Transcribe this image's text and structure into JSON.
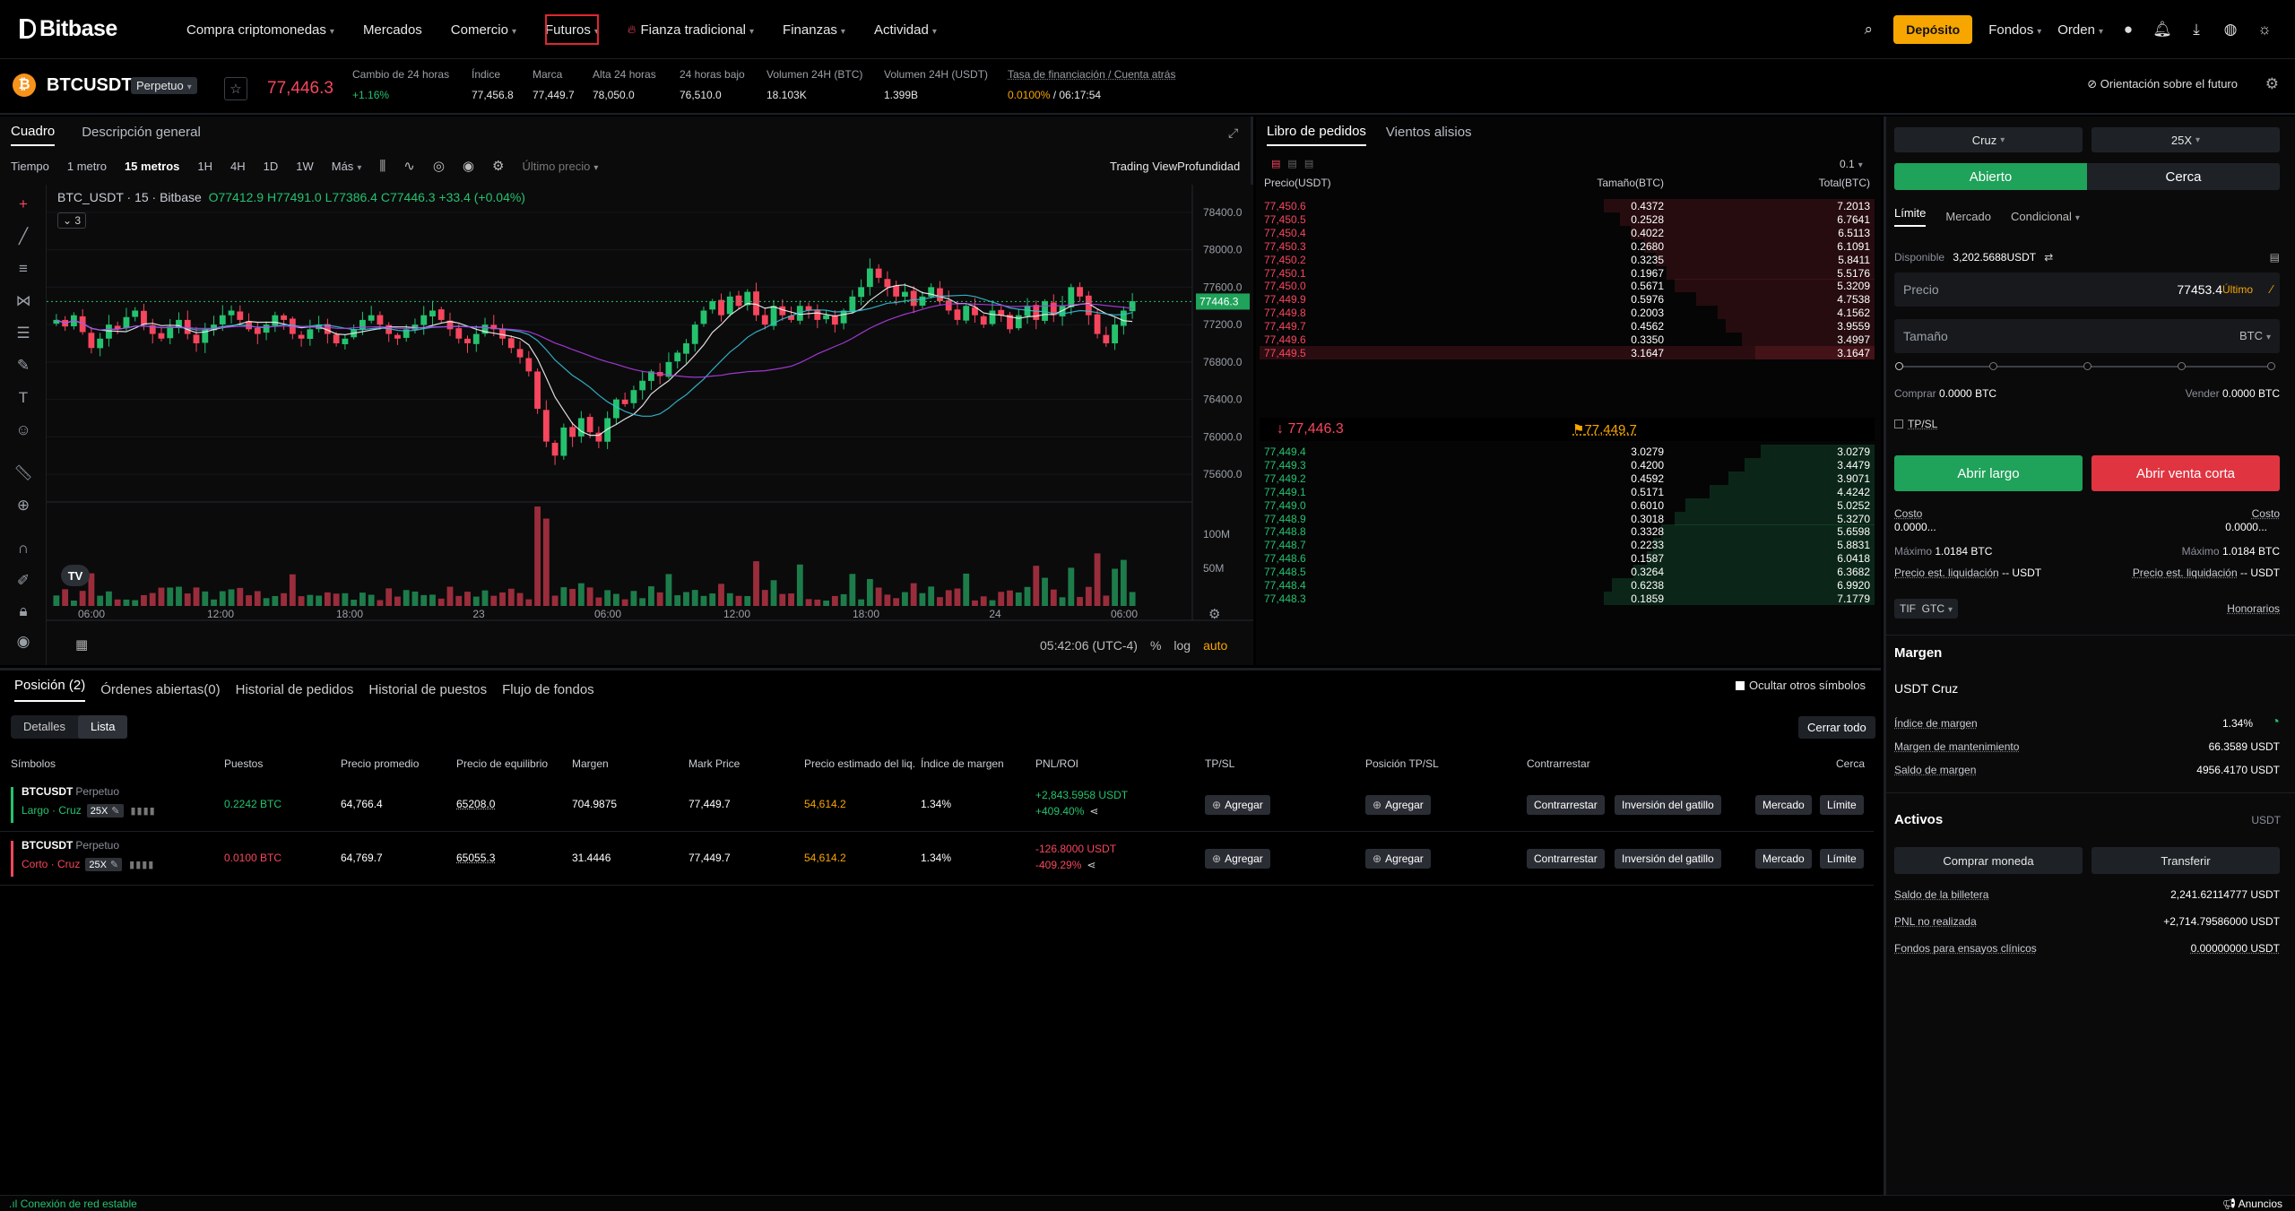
{
  "nav": {
    "logo": "Bitbase",
    "menu": [
      {
        "label": "Compra criptomonedas",
        "caret": true
      },
      {
        "label": "Mercados",
        "caret": false
      },
      {
        "label": "Comercio",
        "caret": true
      },
      {
        "label": "Futuros",
        "caret": true
      },
      {
        "label": "Fianza tradicional",
        "caret": true
      },
      {
        "label": "Finanzas",
        "caret": true
      },
      {
        "label": "Actividad",
        "caret": true
      }
    ],
    "deposit": "Depósito",
    "funds": "Fondos",
    "orders": "Orden"
  },
  "ticker": {
    "coin_glyph": "₿",
    "symbol": "BTCUSDT",
    "contract": "Perpetuo",
    "last_price": "77,446.3",
    "stats": [
      {
        "label": "Cambio de 24 horas",
        "value": "+1.16%",
        "color": "#25c26e"
      },
      {
        "label": "Índice",
        "value": "77,456.8"
      },
      {
        "label": "Marca",
        "value": "77,449.7"
      },
      {
        "label": "Alta 24 horas",
        "value": "78,050.0"
      },
      {
        "label": "24 horas bajo",
        "value": "76,510.0"
      },
      {
        "label": "Volumen 24H (BTC)",
        "value": "18.103K"
      },
      {
        "label": "Volumen 24H (USDT)",
        "value": "1.399B"
      }
    ],
    "funding_label": "Tasa de financiación / Cuenta atrás",
    "funding_rate": "0.0100%",
    "countdown": "/ 06:17:54",
    "guide": "Orientación sobre el futuro"
  },
  "chart": {
    "tabs": [
      "Cuadro",
      "Descripción general"
    ],
    "timeframes": [
      "Tiempo",
      "1 metro",
      "15 metros",
      "1H",
      "4H",
      "1D",
      "1W",
      "Más"
    ],
    "selected_tf": "15 metros",
    "price_type": "Último precio",
    "views": "Trading View",
    "depth": "Profundidad",
    "ohlc_title": "BTC_USDT · 15 · Bitbase",
    "ohlc_values": "O77412.9  H77491.0  L77386.4  C77446.3  +33.4 (+0.04%)",
    "indicator_count": "3",
    "tv_logo": "TV",
    "footer_time": "05:42:06 (UTC-4)",
    "footer_pct": "%",
    "footer_log": "log",
    "footer_auto": "auto"
  },
  "chart_data": {
    "type": "candlestick",
    "title": "BTC_USDT · 15 · Bitbase",
    "price_axis": [
      "78400.0",
      "78000.0",
      "77600.0",
      "77200.0",
      "76800.0",
      "76400.0",
      "76000.0",
      "75600.0"
    ],
    "price_range": [
      75400,
      78600
    ],
    "volume_axis": [
      "100M",
      "50M"
    ],
    "time_axis": [
      "06:00",
      "12:00",
      "18:00",
      "23",
      "06:00",
      "12:00",
      "18:00",
      "24",
      "06:00"
    ],
    "current_price_label": "77446.3",
    "current_price": 77446.3,
    "candles_close": [
      77250,
      77180,
      77300,
      77120,
      76950,
      77050,
      77200,
      77150,
      77280,
      77350,
      77200,
      77100,
      77050,
      77180,
      77250,
      77100,
      77000,
      77150,
      77200,
      77300,
      77350,
      77250,
      77150,
      77100,
      77200,
      77300,
      77250,
      77100,
      77050,
      77150,
      77200,
      77100,
      77000,
      77050,
      77150,
      77250,
      77300,
      77200,
      77100,
      77050,
      77150,
      77200,
      77300,
      77350,
      77250,
      77150,
      77050,
      77000,
      77100,
      77200,
      77150,
      77050,
      76950,
      76850,
      76700,
      76300,
      75950,
      75800,
      76100,
      76000,
      76200,
      76050,
      75950,
      76200,
      76400,
      76350,
      76500,
      76600,
      76700,
      76650,
      76800,
      76900,
      77000,
      77200,
      77350,
      77450,
      77300,
      77500,
      77400,
      77550,
      77300,
      77200,
      77400,
      77300,
      77250,
      77400,
      77350,
      77250,
      77300,
      77200,
      77350,
      77500,
      77600,
      77800,
      77700,
      77600,
      77500,
      77550,
      77400,
      77500,
      77600,
      77450,
      77350,
      77250,
      77400,
      77300,
      77200,
      77350,
      77300,
      77150,
      77300,
      77400,
      77250,
      77450,
      77300,
      77400,
      77600,
      77500,
      77300,
      77100,
      77000,
      77200,
      77350,
      77450
    ],
    "ma_series": [
      {
        "color": "#f5f5f5"
      },
      {
        "color": "#35c0d6"
      },
      {
        "color": "#b13de6"
      }
    ]
  },
  "book": {
    "tabs": [
      "Libro de pedidos",
      "Vientos alisios"
    ],
    "step": "0.1",
    "head": {
      "price": "Precio(USDT)",
      "size": "Tamaño(BTC)",
      "total": "Total(BTC)"
    },
    "asks": [
      {
        "p": "77,450.6",
        "s": "0.4372",
        "t": "7.2013",
        "d": 1.0
      },
      {
        "p": "77,450.5",
        "s": "0.2528",
        "t": "6.7641",
        "d": 0.94
      },
      {
        "p": "77,450.4",
        "s": "0.4022",
        "t": "6.5113",
        "d": 0.9
      },
      {
        "p": "77,450.3",
        "s": "0.2680",
        "t": "6.1091",
        "d": 0.85
      },
      {
        "p": "77,450.2",
        "s": "0.3235",
        "t": "5.8411",
        "d": 0.81
      },
      {
        "p": "77,450.1",
        "s": "0.1967",
        "t": "5.5176",
        "d": 0.77
      },
      {
        "p": "77,450.0",
        "s": "0.5671",
        "t": "5.3209",
        "d": 0.74
      },
      {
        "p": "77,449.9",
        "s": "0.5976",
        "t": "4.7538",
        "d": 0.66
      },
      {
        "p": "77,449.8",
        "s": "0.2003",
        "t": "4.1562",
        "d": 0.58
      },
      {
        "p": "77,449.7",
        "s": "0.4562",
        "t": "3.9559",
        "d": 0.55
      },
      {
        "p": "77,449.6",
        "s": "0.3350",
        "t": "3.4997",
        "d": 0.49
      },
      {
        "p": "77,449.5",
        "s": "3.1647",
        "t": "3.1647",
        "d": 0.44
      }
    ],
    "spread_price": "↓ 77,446.3",
    "mark_price": "77,449.7",
    "bids": [
      {
        "p": "77,449.4",
        "s": "3.0279",
        "t": "3.0279",
        "d": 0.42
      },
      {
        "p": "77,449.3",
        "s": "0.4200",
        "t": "3.4479",
        "d": 0.48
      },
      {
        "p": "77,449.2",
        "s": "0.4592",
        "t": "3.9071",
        "d": 0.54
      },
      {
        "p": "77,449.1",
        "s": "0.5171",
        "t": "4.4242",
        "d": 0.61
      },
      {
        "p": "77,449.0",
        "s": "0.6010",
        "t": "5.0252",
        "d": 0.7
      },
      {
        "p": "77,448.9",
        "s": "0.3018",
        "t": "5.3270",
        "d": 0.74
      },
      {
        "p": "77,448.8",
        "s": "0.3328",
        "t": "5.6598",
        "d": 0.79
      },
      {
        "p": "77,448.7",
        "s": "0.2233",
        "t": "5.8831",
        "d": 0.82
      },
      {
        "p": "77,448.6",
        "s": "0.1587",
        "t": "6.0418",
        "d": 0.84
      },
      {
        "p": "77,448.5",
        "s": "0.3264",
        "t": "6.3682",
        "d": 0.89
      },
      {
        "p": "77,448.4",
        "s": "0.6238",
        "t": "6.9920",
        "d": 0.97
      },
      {
        "p": "77,448.3",
        "s": "0.1859",
        "t": "7.1779",
        "d": 1.0
      }
    ]
  },
  "form": {
    "margin_mode": "Cruz",
    "leverage": "25X",
    "open": "Abierto",
    "close": "Cerca",
    "order_types": [
      "Límite",
      "Mercado",
      "Condicional"
    ],
    "available_label": "Disponible",
    "available_value": "3,202.5688USDT",
    "price_label": "Precio",
    "price_value": "77453.4",
    "price_last": "Último",
    "size_label": "Tamaño",
    "size_unit": "BTC",
    "buy_label": "Comprar",
    "buy_value": "0.0000 BTC",
    "sell_label": "Vender",
    "sell_value": "0.0000 BTC",
    "tpsl": "TP/SL",
    "open_long": "Abrir largo",
    "open_short": "Abrir venta corta",
    "cost_label": "Costo",
    "cost_value": "0.0000...",
    "max_label": "Máximo",
    "max_value": "1.0184 BTC",
    "liq_label": "Precio est. liquidación",
    "liq_value": "-- USDT",
    "tif": "TIF",
    "gtc": "GTC",
    "fees": "Honorarios",
    "margin_title": "Margen",
    "margin_sub": "USDT Cruz",
    "margin_index_label": "Índice de margen",
    "margin_index_value": "1.34%",
    "maint_label": "Margen de mantenimiento",
    "maint_value": "66.3589 USDT",
    "balance_label": "Saldo de margen",
    "balance_value": "4956.4170 USDT",
    "assets_title": "Activos",
    "assets_unit": "USDT",
    "buy_coin": "Comprar moneda",
    "transfer": "Transferir",
    "wallet_label": "Saldo de la billetera",
    "wallet_value": "2,241.62114777 USDT",
    "upnl_label": "PNL no realizada",
    "upnl_value": "+2,714.79586000 USDT",
    "trial_label": "Fondos para ensayos clínicos",
    "trial_value": "0.00000000 USDT"
  },
  "positions": {
    "tabs": [
      "Posición (2)",
      "Órdenes abiertas(0)",
      "Historial de pedidos",
      "Historial de puestos",
      "Flujo de fondos"
    ],
    "hide_others": "Ocultar otros símbolos",
    "views": [
      "Detalles",
      "Lista"
    ],
    "close_all": "Cerrar todo",
    "head": [
      "Símbolos",
      "Puestos",
      "Precio promedio",
      "Precio de equilibrio",
      "Margen",
      "Mark Price",
      "Precio estimado del liq.",
      "Índice de margen",
      "PNL/ROI",
      "TP/SL",
      "Posición TP/SL",
      "Contrarrestar",
      "Cerca"
    ],
    "rows": [
      {
        "symbol": "BTCUSDT",
        "type": "Perpetuo",
        "side": "Largo · Cruz",
        "lev": "25X",
        "qty": "0.2242 BTC",
        "avg": "64,766.4",
        "breakeven": "65208.0",
        "margin": "704.9875",
        "mark": "77,449.7",
        "liq": "54,614.2",
        "mindex": "1.34%",
        "pnl": "+2,843.5958 USDT",
        "roi": "+409.40%",
        "color": "#25c26e"
      },
      {
        "symbol": "BTCUSDT",
        "type": "Perpetuo",
        "side": "Corto · Cruz",
        "lev": "25X",
        "qty": "0.0100 BTC",
        "avg": "64,769.7",
        "breakeven": "65055.3",
        "margin": "31.4446",
        "mark": "77,449.7",
        "liq": "54,614.2",
        "mindex": "1.34%",
        "pnl": "-126.8000 USDT",
        "roi": "-409.29%",
        "color": "#f6465d"
      }
    ],
    "add": "Agregar",
    "counter": "Contrarrestar",
    "trigger": "Inversión del gatillo",
    "market": "Mercado",
    "limit": "Límite"
  },
  "status": {
    "network": "Conexión de red estable",
    "news": "Anuncios"
  }
}
